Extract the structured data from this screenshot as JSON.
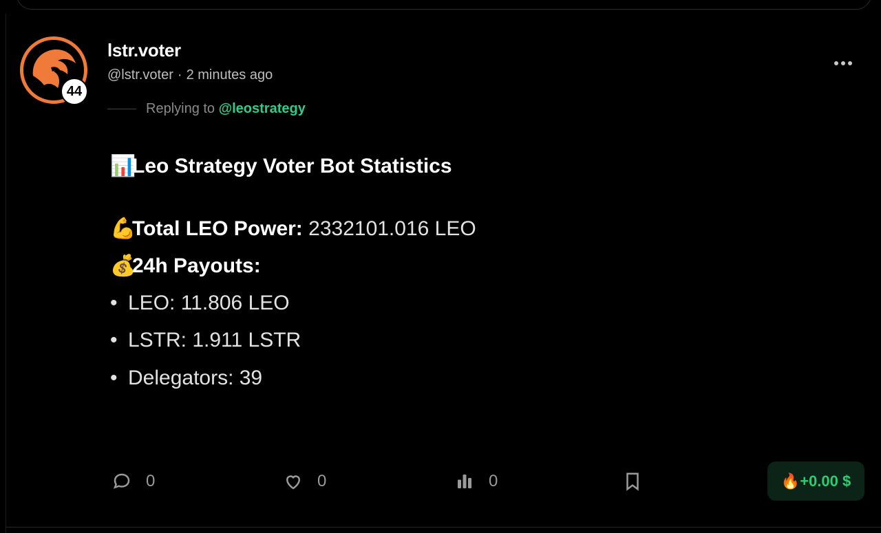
{
  "post": {
    "author_name": "lstr.voter",
    "handle": "@lstr.voter",
    "separator": "·",
    "time": "2 minutes ago",
    "reputation": "44",
    "replying_prefix": "Replying to",
    "replying_to": "@leostrategy"
  },
  "body": {
    "title_emoji": "📊",
    "title": "Leo Strategy Voter Bot Statistics",
    "power_emoji": "💪",
    "power_label": "Total LEO Power:",
    "power_value": "2332101.016 LEO",
    "payouts_emoji": "💰",
    "payouts_label": "24h Payouts:",
    "bullets": [
      "LEO: 11.806 LEO",
      "LSTR: 1.911 LSTR",
      "Delegators: 39"
    ]
  },
  "actions": {
    "comments": "0",
    "likes": "0",
    "views": "0",
    "tip_label": "🔥+0.00 $"
  },
  "icons": {
    "more": "more-horizontal-icon",
    "comment": "comment-bubble-icon",
    "like": "heart-icon",
    "views": "bar-chart-icon",
    "bookmark": "bookmark-icon"
  },
  "colors": {
    "accent": "#2ecc8a",
    "avatar_ring": "#f07a3a",
    "tip_bg": "#0b2417",
    "tip_text": "#2ecc71"
  }
}
